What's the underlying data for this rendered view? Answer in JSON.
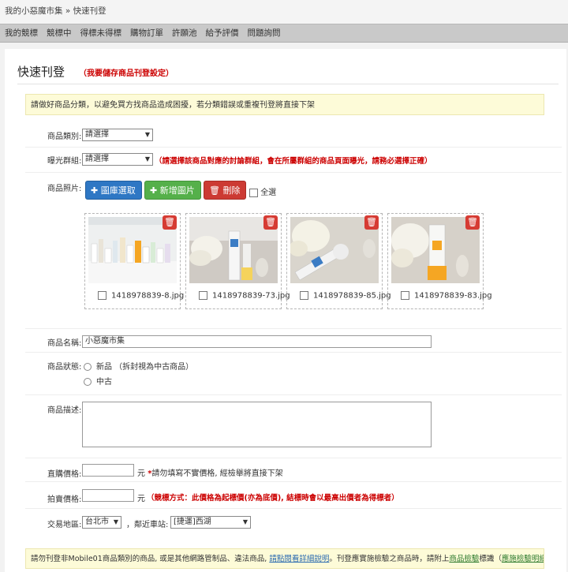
{
  "breadcrumb": {
    "home": "我的小惡魔市集",
    "sep": "»",
    "current": "快速刊登"
  },
  "tabs": [
    "我的競標",
    "競標中",
    "得標未得標",
    "購物訂單",
    "許願池",
    "給予評價",
    "問題詢問"
  ],
  "header": {
    "title": "快速刊登",
    "subtitle": "（我要儲存商品刊登設定）"
  },
  "notice": "請做好商品分類，以避免買方找商品造成困擾，若分類錯誤或重複刊登將直接下架",
  "form": {
    "category": {
      "label": "商品類別:",
      "value": "請選擇"
    },
    "exposure": {
      "label": "曝光群組:",
      "value": "請選擇",
      "hint": "（請選擇該商品對應的討論群組，會在所屬群組的商品頁面曝光，請務必選擇正確）"
    },
    "photos": {
      "label": "商品照片:",
      "gallery_button": "圖庫選取",
      "add_button": "新增圖片",
      "delete_button": "刪除",
      "select_all": "全選",
      "items": [
        {
          "filename": "1418978839-8.jpg"
        },
        {
          "filename": "1418978839-73.jpg"
        },
        {
          "filename": "1418978839-85.jpg"
        },
        {
          "filename": "1418978839-83.jpg"
        }
      ]
    },
    "name": {
      "label": "商品名稱:",
      "value": "小惡魔市集"
    },
    "condition": {
      "label": "商品狀態:",
      "options": [
        "新品 （拆封視為中古商品）",
        "中古"
      ]
    },
    "description": {
      "label": "商品描述:"
    },
    "buy_now": {
      "label": "直購價格:",
      "unit": "元",
      "star": "*",
      "hint": "請勿填寫不實價格, 經檢舉將直接下架"
    },
    "auction": {
      "label": "拍賣價格:",
      "unit": "元",
      "hint": "（競標方式：此價格為起標價(亦為底價), 結標時會以最高出價者為得標者）"
    },
    "location": {
      "label": "交易地區:",
      "city": "台北市",
      "station_label": "，鄰近車站:",
      "station": "[捷運]西湖"
    }
  },
  "bottom_notice": {
    "text1": "請勿刊登非Mobile01商品類別的商品, 或是其他網路管制品、違法商品,",
    "link1": "請點閱看詳細說明",
    "text2": "。刊登應實施檢驗之商品時，請附上",
    "link2": "商品檢驗",
    "text3": "標識（",
    "link3": "應施檢驗明細表",
    "text4": "）"
  }
}
